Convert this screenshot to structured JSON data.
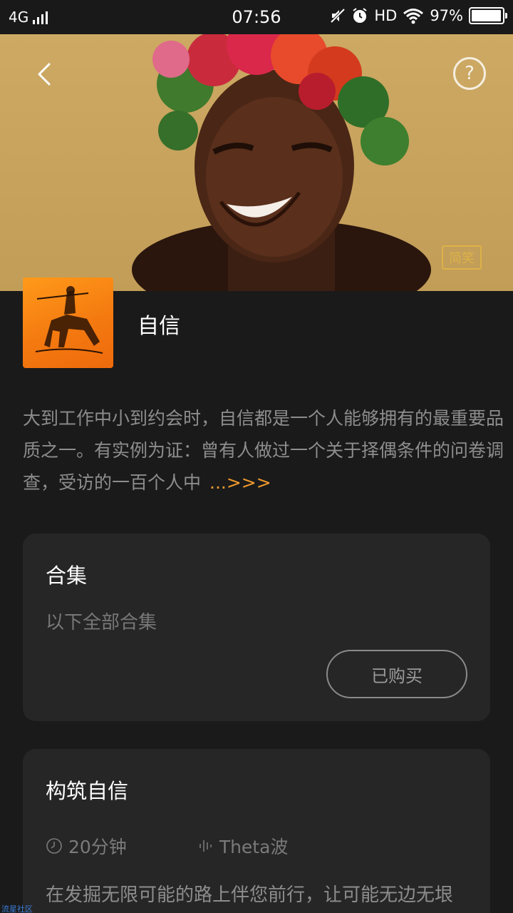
{
  "status_bar": {
    "network": "4G",
    "time": "07:56",
    "hd": "HD",
    "battery": "97%",
    "battery_level": 0.97
  },
  "hero": {
    "watermark": "简笑"
  },
  "album": {
    "title": "自信",
    "description": "大到工作中小到约会时，自信都是一个人能够拥有的最重要品质之一。有实例为证：曾有人做过一个关于择偶条件的问卷调查，受访的一百个人中",
    "more": "...>>>"
  },
  "collection": {
    "title": "合集",
    "subtitle": "以下全部合集",
    "button": "已购买"
  },
  "track": {
    "title": "构筑自信",
    "duration": "20分钟",
    "wave": "Theta波",
    "description": "在发掘无限可能的路上伴您前行，让可能无边无垠"
  },
  "corner_mark": "流星社区",
  "icons": {
    "back": "chevron-left-icon",
    "help": "question-circle-icon",
    "clock": "clock-icon",
    "wave": "sound-wave-icon"
  },
  "colors": {
    "background": "#1a1a1a",
    "card": "#262626",
    "accent": "#f09a2e",
    "cover": "#f47a10"
  }
}
